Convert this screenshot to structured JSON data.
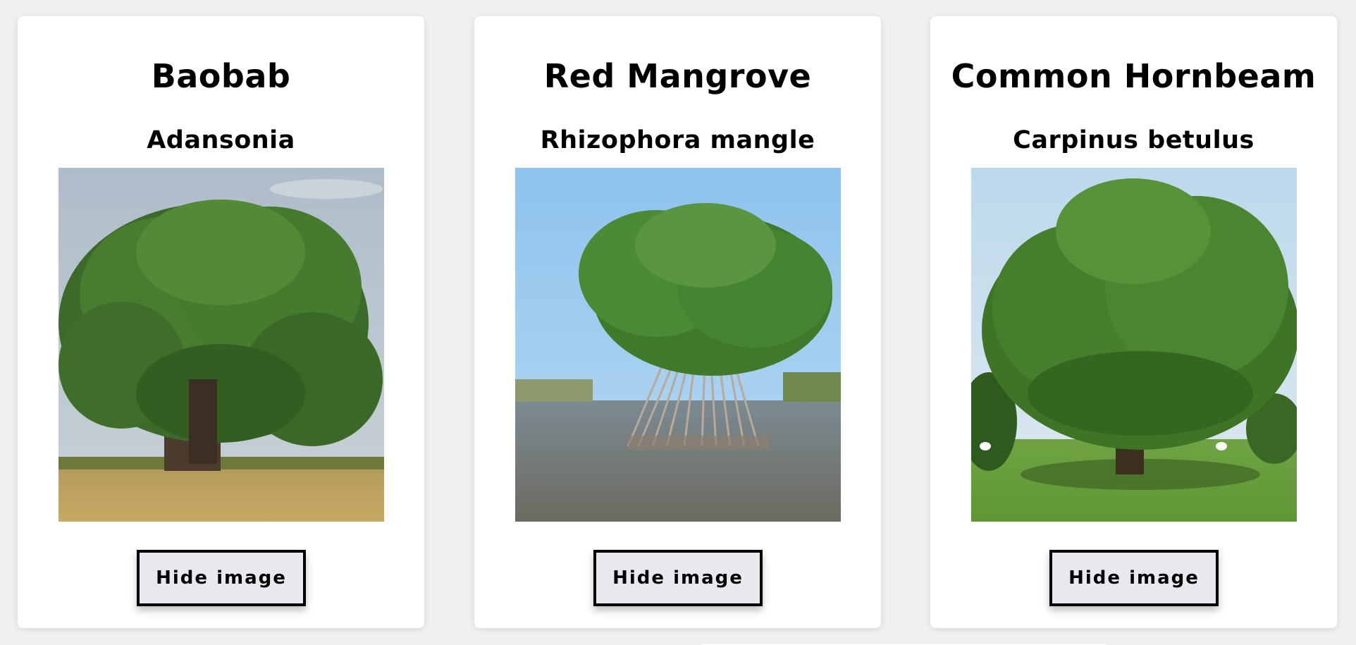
{
  "cards": [
    {
      "common_name": "Baobab",
      "latin_name": "Adansonia",
      "image_subject": "baobab tree in savanna grass",
      "button_label": "Hide image"
    },
    {
      "common_name": "Red Mangrove",
      "latin_name": "Rhizophora mangle",
      "image_subject": "red mangrove standing in water with prop roots",
      "button_label": "Hide image"
    },
    {
      "common_name": "Common Hornbeam",
      "latin_name": "Carpinus betulus",
      "image_subject": "hornbeam tree in a green meadow",
      "button_label": "Hide image"
    }
  ],
  "colors": {
    "page_background": "#f0f0f0",
    "card_background": "#ffffff",
    "button_background": "#e9e8ee",
    "button_border": "#000000",
    "text": "#000000"
  }
}
